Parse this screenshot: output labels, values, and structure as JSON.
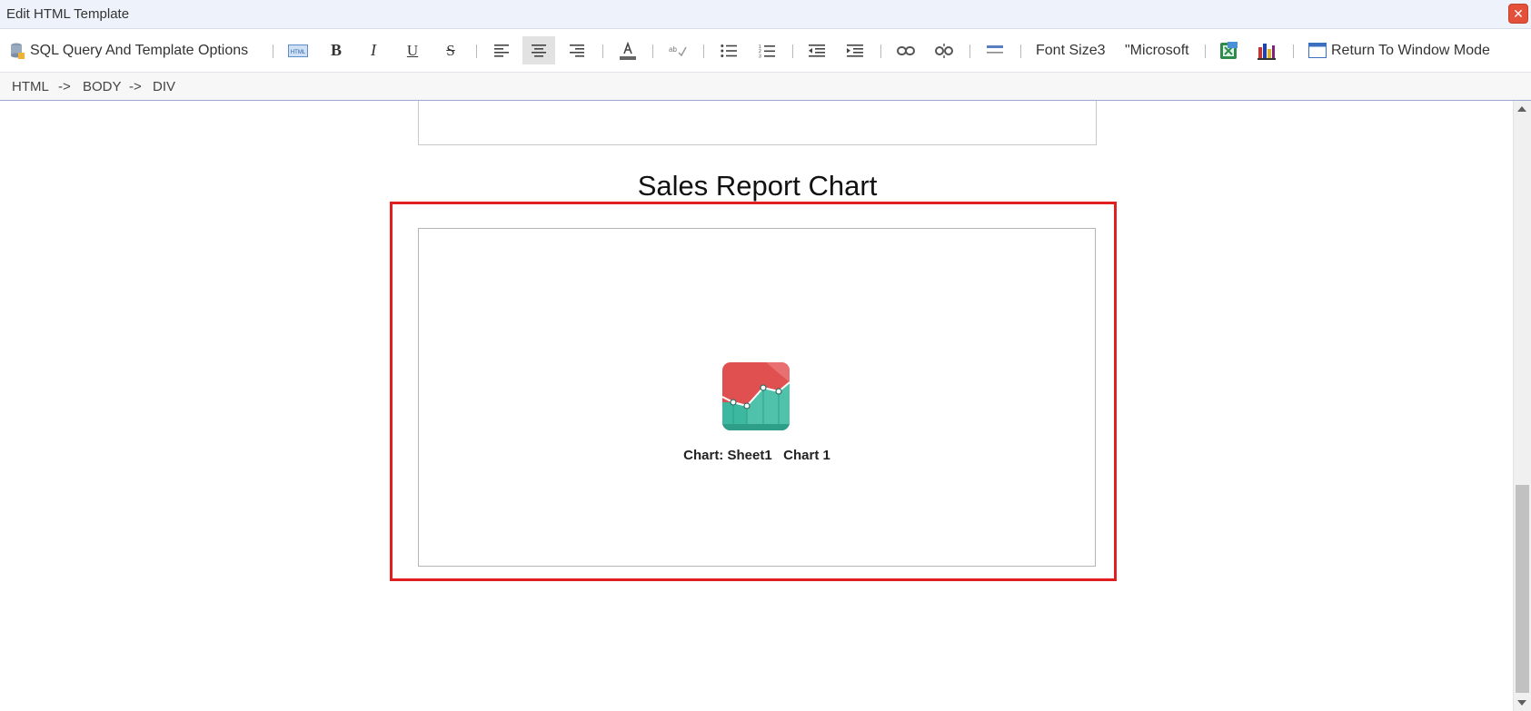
{
  "window": {
    "title": "Edit HTML Template",
    "close_label": "✕"
  },
  "toolbar": {
    "sql_options_label": "SQL Query And Template Options",
    "html_icon_label": "HTML",
    "bold_label": "B",
    "italic_label": "I",
    "underline_label": "U",
    "strike_label": "S",
    "font_size_label": "Font Size3",
    "font_family_label": "\"Microsoft",
    "return_label": "Return To Window Mode",
    "active_align": "center"
  },
  "breadcrumb": {
    "items": [
      "HTML",
      "BODY",
      "DIV"
    ],
    "separator": "->"
  },
  "document": {
    "heading": "Sales Report Chart",
    "chart_caption": "Chart: Sheet1   Chart 1"
  },
  "colors": {
    "selection_frame": "#e02020",
    "chart_icon_top": "#e05050",
    "chart_icon_bottom": "#3cb8a0"
  }
}
